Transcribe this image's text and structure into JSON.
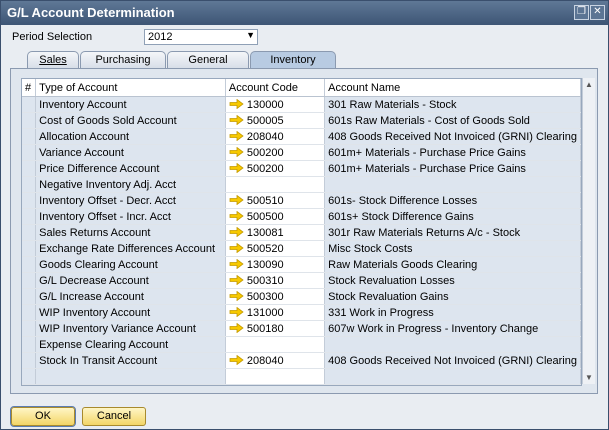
{
  "window": {
    "title": "G/L Account Determination",
    "restore_glyph": "❐",
    "close_glyph": "✕"
  },
  "period": {
    "label": "Period Selection",
    "value": "2012"
  },
  "tabs": [
    "Sales",
    "Purchasing",
    "General",
    "Inventory"
  ],
  "grid": {
    "headers": {
      "num": "#",
      "type": "Type of Account",
      "code": "Account Code",
      "name": "Account Name"
    },
    "rows": [
      {
        "type": "Inventory Account",
        "code": "130000",
        "name": "301 Raw Materials - Stock"
      },
      {
        "type": "Cost of Goods Sold Account",
        "code": "500005",
        "name": "601s Raw Materials - Cost of Goods Sold"
      },
      {
        "type": "Allocation Account",
        "code": "208040",
        "name": "408 Goods Received Not Invoiced (GRNI) Clearing"
      },
      {
        "type": "Variance Account",
        "code": "500200",
        "name": "601m+ Materials - Purchase Price Gains"
      },
      {
        "type": "Price Difference Account",
        "code": "500200",
        "name": "601m+ Materials - Purchase Price Gains"
      },
      {
        "type": "Negative Inventory Adj. Acct",
        "code": "",
        "name": ""
      },
      {
        "type": "Inventory Offset - Decr. Acct",
        "code": "500510",
        "name": "601s- Stock Difference Losses"
      },
      {
        "type": "Inventory Offset - Incr. Acct",
        "code": "500500",
        "name": "601s+ Stock Difference Gains"
      },
      {
        "type": "Sales Returns Account",
        "code": "130081",
        "name": "301r Raw Materials Returns A/c - Stock"
      },
      {
        "type": "Exchange Rate Differences Account",
        "code": "500520",
        "name": "Misc Stock Costs"
      },
      {
        "type": "Goods Clearing Account",
        "code": "130090",
        "name": "Raw Materials Goods Clearing"
      },
      {
        "type": "G/L Decrease Account",
        "code": "500310",
        "name": "Stock Revaluation Losses"
      },
      {
        "type": "G/L Increase Account",
        "code": "500300",
        "name": "Stock Revaluation Gains"
      },
      {
        "type": "WIP Inventory Account",
        "code": "131000",
        "name": "331 Work in Progress"
      },
      {
        "type": "WIP Inventory Variance Account",
        "code": "500180",
        "name": "607w Work in Progress - Inventory Change"
      },
      {
        "type": "Expense Clearing Account",
        "code": "",
        "name": ""
      },
      {
        "type": "Stock In Transit Account",
        "code": "208040",
        "name": "408 Goods Received Not Invoiced (GRNI) Clearing"
      },
      {
        "type": "",
        "code": "",
        "name": ""
      }
    ]
  },
  "buttons": {
    "ok": "OK",
    "cancel": "Cancel"
  },
  "colors": {
    "accent": "#3d5575",
    "active_tab": "#b8cbe2",
    "button": "#f3d567",
    "link_arrow": "#f7c900"
  }
}
